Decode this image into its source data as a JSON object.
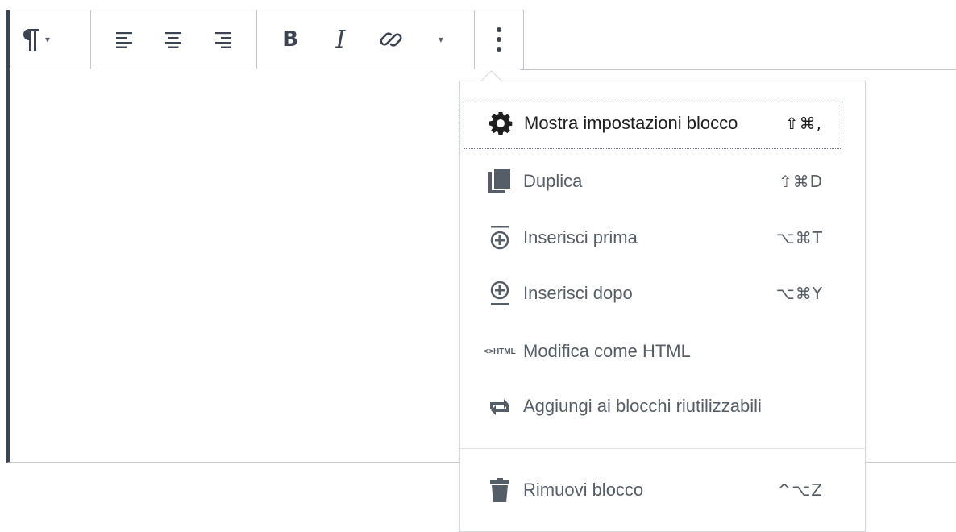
{
  "toolbar": {
    "paragraph_icon": "pilcrow-icon",
    "align_icons": [
      "align-left-icon",
      "align-center-icon",
      "align-right-icon"
    ],
    "bold_label": "B",
    "italic_label": "I",
    "link_icon": "link-icon",
    "more_icon": "vertical-ellipsis-icon"
  },
  "menu": {
    "items": [
      {
        "icon": "gear-icon",
        "label": "Mostra impostazioni blocco",
        "shortcut": "⇧⌘,"
      },
      {
        "icon": "duplicate-icon",
        "label": "Duplica",
        "shortcut": "⇧⌘D"
      },
      {
        "icon": "insert-before-icon",
        "label": "Inserisci prima",
        "shortcut": "⌥⌘T"
      },
      {
        "icon": "insert-after-icon",
        "label": "Inserisci dopo",
        "shortcut": "⌥⌘Y"
      },
      {
        "icon": "html-icon",
        "label": "Modifica come HTML",
        "shortcut": ""
      },
      {
        "icon": "reusable-icon",
        "label": "Aggiungi ai blocchi riutilizzabili",
        "shortcut": ""
      }
    ],
    "remove": {
      "icon": "trash-icon",
      "label": "Rimuovi blocco",
      "shortcut": "^⌥Z"
    },
    "html_icon_text": [
      "<>",
      "HTML"
    ]
  },
  "colors": {
    "accent": "#3d4451",
    "text": "#555d66",
    "active_text": "#1e1e1e"
  }
}
